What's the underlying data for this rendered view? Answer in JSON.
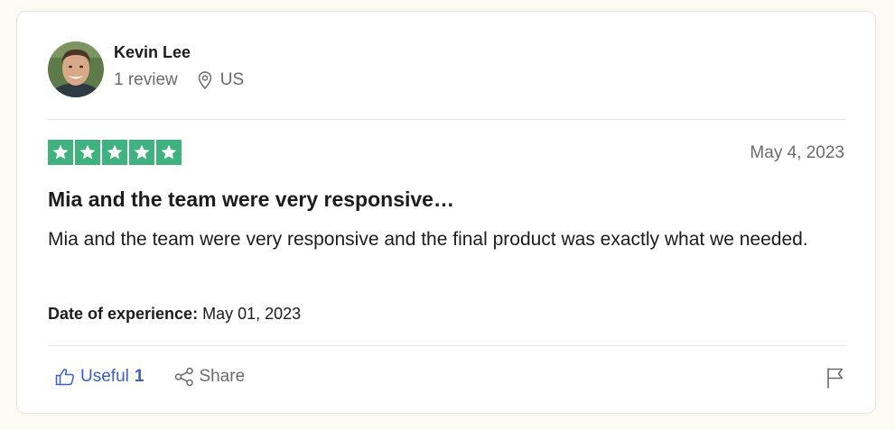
{
  "reviewer": {
    "name": "Kevin Lee",
    "review_count": "1 review",
    "location": "US"
  },
  "review": {
    "rating": 5,
    "rating_max": 5,
    "date": "May 4, 2023",
    "title": "Mia and the team were very responsive…",
    "body": "Mia and the team were very responsive and the final product was exactly what we needed.",
    "experience_label": "Date of experience:",
    "experience_date": "May 01, 2023"
  },
  "actions": {
    "useful_label": "Useful",
    "useful_count": "1",
    "share_label": "Share",
    "icons": {
      "useful": "thumbs-up-icon",
      "share": "share-icon",
      "report": "flag-icon",
      "location": "location-pin-icon"
    }
  },
  "colors": {
    "star_green": "#3fb27f",
    "link_blue": "#3a5fcd",
    "muted_text": "#6b6b6b",
    "page_bg": "#fbfaf3"
  }
}
